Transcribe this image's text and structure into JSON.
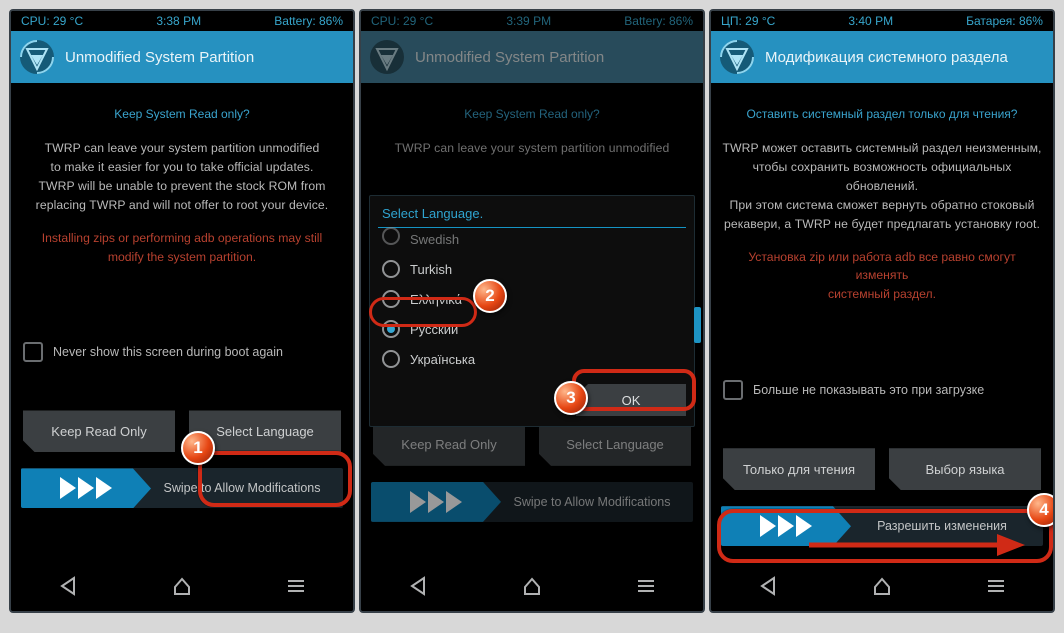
{
  "s1": {
    "status": {
      "cpu": "CPU: 29 °C",
      "time": "3:38 PM",
      "batt": "Battery:  86%"
    },
    "title": "Unmodified System Partition",
    "prompt": "Keep System Read only?",
    "desc1": "TWRP can leave your system partition unmodified",
    "desc2": "to make it easier for you to take official updates.",
    "desc3": "TWRP will be unable to prevent the stock ROM from",
    "desc4": "replacing TWRP and will not offer to root your device.",
    "warn1": "Installing zips or performing adb operations may still",
    "warn2": "modify the system partition.",
    "checkbox_label": "Never show this screen during boot again",
    "btn_keep": "Keep Read Only",
    "btn_lang": "Select Language",
    "swipe": "Swipe to Allow Modifications"
  },
  "s2": {
    "status": {
      "cpu": "CPU: 29 °C",
      "time": "3:39 PM",
      "batt": "Battery:  86%"
    },
    "title": "Unmodified System Partition",
    "prompt": "Keep System Read only?",
    "desc1": "TWRP can leave your system partition unmodified",
    "dialog_title": "Select Language.",
    "lang_swedish": "Swedish",
    "lang_turkish": "Turkish",
    "lang_greek": "Ελληνικά",
    "lang_russian": "Русский",
    "lang_ukrainian": "Українська",
    "selected_language": "Русский",
    "ok": "OK",
    "btn_keep": "Keep Read Only",
    "btn_lang": "Select Language",
    "swipe": "Swipe to Allow Modifications"
  },
  "s3": {
    "status": {
      "cpu": "ЦП: 29 °C",
      "time": "3:40 PM",
      "batt": "Батарея:  86%"
    },
    "title": "Модификация системного раздела",
    "prompt": "Оставить системный раздел только для чтения?",
    "desc1": "TWRP может оставить системный раздел неизменным,",
    "desc2": "чтобы сохранить возможность официальных обновлений.",
    "desc3": "При этом система сможет вернуть обратно стоковый",
    "desc4": "рекавери, а TWRP не будет предлагать установку root.",
    "warn1": "Установка zip или работа adb все равно смогут изменять",
    "warn2": "системный раздел.",
    "checkbox_label": "Больше не показывать это при загрузке",
    "btn_keep": "Только для чтения",
    "btn_lang": "Выбор языка",
    "swipe": "Разрешить изменения"
  },
  "callouts": {
    "n1": "1",
    "n2": "2",
    "n3": "3",
    "n4": "4"
  }
}
